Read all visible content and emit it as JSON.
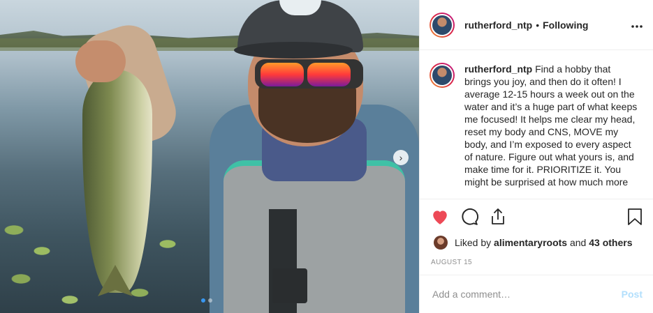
{
  "post": {
    "username": "rutherford_ntp",
    "bullet": "•",
    "follow_status": "Following",
    "more_label": "•••",
    "caption_text": "Find a hobby that brings you joy, and then do it often! I average 12-15 hours a week out on the water and it’s a huge part of what keeps me focused! It helps me clear my head, reset my body and CNS, MOVE my body, and I’m exposed to every aspect of nature. Figure out what yours is, and make time for it. PRIORITIZE it. You might be surprised at how much more",
    "liked_by_prefix": "Liked by",
    "liked_by_user": "alimentaryroots",
    "liked_by_and": "and",
    "liked_by_others": "43 others",
    "date": "AUGUST 15",
    "comment_placeholder": "Add a comment…",
    "post_label": "Post",
    "photo_carousel": {
      "total": 2,
      "current": 1,
      "next_arrow": "›"
    }
  },
  "colors": {
    "like_heart": "#ed4956",
    "post_disabled": "#b2dffc",
    "muted": "#8e8e8e"
  },
  "icons": [
    "heart-icon",
    "comment-icon",
    "share-icon",
    "bookmark-icon",
    "more-icon",
    "chevron-right-icon"
  ]
}
